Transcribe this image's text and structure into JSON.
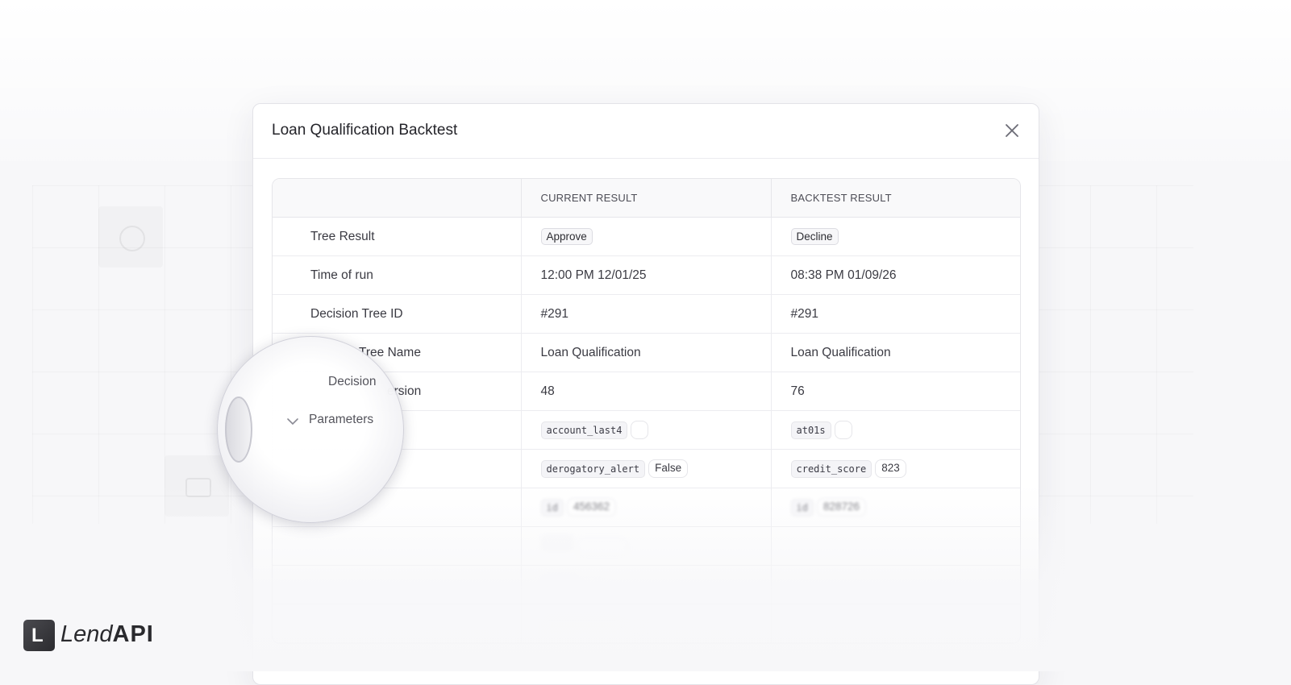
{
  "modal": {
    "title": "Loan Qualification Backtest"
  },
  "table": {
    "headers": [
      "",
      "CURRENT RESULT",
      "BACKTEST RESULT"
    ],
    "rows": [
      {
        "label": "Tree Result",
        "current": "Approve",
        "backtest": "Decline"
      },
      {
        "label": "Time of run",
        "current": "12:00 PM 12/01/25",
        "backtest": "08:38 PM 01/09/26"
      },
      {
        "label": "Decision Tree ID",
        "current": "#291",
        "backtest": "#291"
      },
      {
        "label": "Tree Name",
        "current": "Loan Qualification",
        "backtest": "Loan Qualification"
      },
      {
        "label": "Decision",
        "label_suffix": "ersion",
        "current": "48",
        "backtest": "76"
      }
    ],
    "parameters": {
      "label": "Parameters",
      "rows": [
        {
          "current_key": "account_last4",
          "current_val": "",
          "backtest_key": "at01s",
          "backtest_val": ""
        },
        {
          "current_key": "derogatory_alert",
          "current_val": "False",
          "backtest_key": "credit_score",
          "backtest_val": "823"
        },
        {
          "current_key": "id",
          "current_val": "456362",
          "backtest_key": "id",
          "backtest_val": "828726"
        }
      ]
    }
  },
  "logo": {
    "letter": "L",
    "part1": "Lend",
    "part2": "API"
  },
  "colors": {
    "background": "#f7f7f9",
    "modal_border": "#e3e3e8",
    "text": "#2b2b31"
  },
  "icons": {
    "close": "close-icon",
    "expand": "chevron-down-icon"
  }
}
